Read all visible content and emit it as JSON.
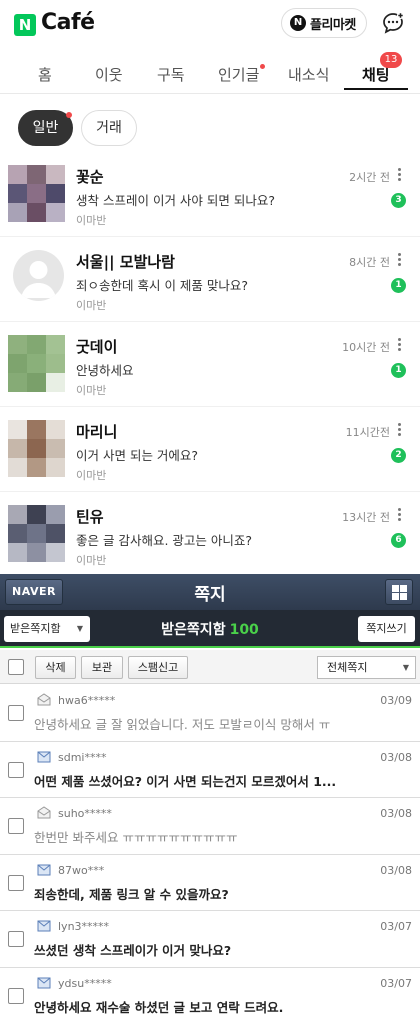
{
  "header": {
    "logo_mark": "N",
    "logo_text": "Café",
    "flea_mark": "N",
    "flea_label": "플리마켓"
  },
  "tabs": [
    {
      "label": "홈"
    },
    {
      "label": "이웃"
    },
    {
      "label": "구독"
    },
    {
      "label": "인기글"
    },
    {
      "label": "내소식"
    },
    {
      "label": "채팅",
      "badge": "13"
    }
  ],
  "filters": {
    "general": "일반",
    "trade": "거래"
  },
  "chats": [
    {
      "name": "꽃순",
      "message": "생착 스프레이 이거 사야 되면 되나요?",
      "sub": "이마반",
      "time": "2시간 전",
      "unread": "3"
    },
    {
      "name": "서울|| 모발나람",
      "message": "죄ㅇ송한데 혹시 이 제품 맞나요?",
      "sub": "이마반",
      "time": "8시간 전",
      "unread": "1"
    },
    {
      "name": "굿데이",
      "message": "안녕하세요",
      "sub": "이마반",
      "time": "10시간 전",
      "unread": "1"
    },
    {
      "name": "마리니",
      "message": "이거 사면 되는 거에요?",
      "sub": "이마반",
      "time": "11시간전",
      "unread": "2"
    },
    {
      "name": "틴유",
      "message": "좋은 글 감사해요. 광고는 아니죠?",
      "sub": "이마반",
      "time": "13시간 전",
      "unread": "6"
    }
  ],
  "note": {
    "naver_label": "NAVER",
    "title": "쪽지",
    "inbox_select": "받은쪽지함",
    "inbox_label": "받은쪽지함",
    "inbox_count": "100",
    "write_label": "쪽지쓰기",
    "toolbar": {
      "delete": "삭제",
      "keep": "보관",
      "spam": "스팸신고",
      "filter": "전체쪽지"
    },
    "messages": [
      {
        "sender": "hwa6*****",
        "date": "03/09",
        "text": "안녕하세요 글 잘 읽었습니다. 저도 모발ㄹ이식 망해서 ㅠ",
        "read": true
      },
      {
        "sender": "sdmi****",
        "date": "03/08",
        "text": "어떤 제품 쓰셨어요? 이거 사면 되는건지 모르겠어서 1...",
        "read": false
      },
      {
        "sender": "suho*****",
        "date": "03/08",
        "text": "한번만 봐주세요 ㅠㅠㅠㅠㅠㅠㅠㅠㅠㅠ",
        "read": true
      },
      {
        "sender": "87wo***",
        "date": "03/08",
        "text": "죄송한데, 제품 링크 알 수 있을까요?",
        "read": false
      },
      {
        "sender": "lyn3*****",
        "date": "03/07",
        "text": "쓰셨던 생착 스프레이가 이거 맞나요?",
        "read": false
      },
      {
        "sender": "ydsu*****",
        "date": "03/07",
        "text": "안녕하세요 재수술 하셨던 글 보고 연락 드려요.",
        "read": false
      }
    ]
  },
  "colors": {
    "brand_green": "#03c75a",
    "badge_red": "#f0494a",
    "unread_green": "#1fc05a",
    "note_header": "#3e4e66",
    "note_accent": "#4ad14a"
  }
}
